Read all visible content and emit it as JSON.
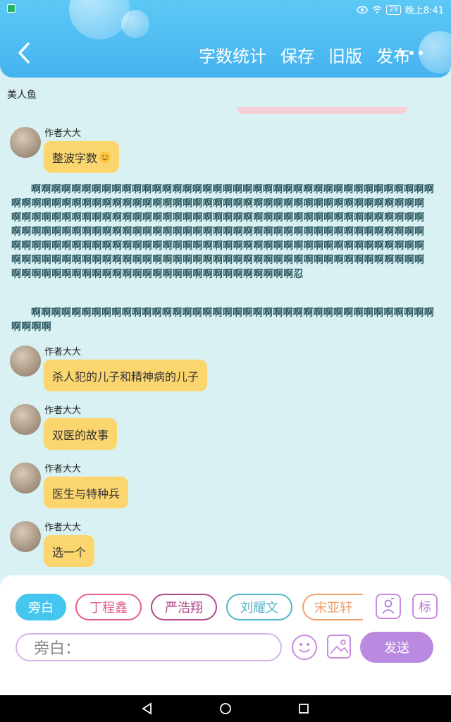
{
  "status": {
    "battery": "29",
    "time": "晚上8:41"
  },
  "header": {
    "menu": [
      "字数统计",
      "保存",
      "旧版",
      "发布"
    ]
  },
  "story_title": "美人鱼",
  "messages_top": [
    {
      "author": "作者大大",
      "text": "整波字数"
    }
  ],
  "narration": [
    "啊啊啊啊啊啊啊啊啊啊啊啊啊啊啊啊啊啊啊啊啊啊啊啊啊啊啊啊啊啊啊啊啊啊啊啊啊啊啊啊啊啊啊啊啊啊啊啊啊啊啊啊啊啊啊啊啊啊啊啊啊啊啊啊啊啊啊啊啊啊啊啊啊啊啊啊啊啊啊啊啊啊啊啊啊啊啊啊啊啊啊啊啊啊啊啊啊啊啊啊啊啊啊啊啊啊啊啊啊啊啊啊啊啊啊啊啊啊啊啊啊啊啊啊啊啊啊啊啊啊啊啊啊啊啊啊啊啊啊啊啊啊啊啊啊啊啊啊啊啊啊啊啊啊啊啊啊啊啊啊啊啊啊啊啊啊啊啊啊啊啊啊啊啊啊啊啊啊啊啊啊啊啊啊啊啊啊啊啊啊啊啊啊啊啊啊啊啊啊啊啊啊啊啊啊啊啊啊啊啊啊啊啊啊啊啊啊啊啊啊啊啊啊啊啊啊啊啊啊啊啊啊啊啊啊啊啊啊啊啊啊啊啊啊啊啊啊啊啊啊啊啊啊啊啊啊啊啊啊啊啊啊啊啊啊啊啊啊啊啊啊啊啊忍",
    "啊啊啊啊啊啊啊啊啊啊啊啊啊啊啊啊啊啊啊啊啊啊啊啊啊啊啊啊啊啊啊啊啊啊啊啊啊啊啊啊啊啊啊啊"
  ],
  "messages_bottom": [
    {
      "author": "作者大大",
      "text": "杀人犯的儿子和精神病的儿子"
    },
    {
      "author": "作者大大",
      "text": "双医的故事"
    },
    {
      "author": "作者大大",
      "text": "医生与特种兵"
    },
    {
      "author": "作者大大",
      "text": "选一个"
    }
  ],
  "characters": [
    {
      "name": "旁白",
      "color": "#45c6ee",
      "filled": true
    },
    {
      "name": "丁程鑫",
      "color": "#e0608f",
      "filled": false
    },
    {
      "name": "严浩翔",
      "color": "#b04a8c",
      "filled": false
    },
    {
      "name": "刘耀文",
      "color": "#4fb6c6",
      "filled": false
    },
    {
      "name": "宋亚轩",
      "color": "#f0a06a",
      "filled": false
    }
  ],
  "tool_icons": {
    "person": "person-card-icon",
    "tag_label": "标"
  },
  "input": {
    "placeholder": "旁白："
  },
  "send_label": "发送"
}
